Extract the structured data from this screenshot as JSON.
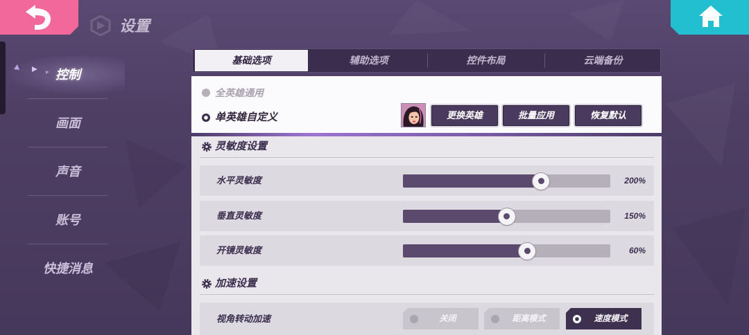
{
  "header": {
    "title": "设置",
    "back_icon": "back-arrow-icon",
    "home_icon": "home-icon",
    "logo_icon": "game-logo-icon"
  },
  "colors": {
    "back_button": "#f2689a",
    "home_button": "#22bfd0",
    "accent": "#3b2e4e",
    "slider_fill": "#5c4a6e",
    "slider_track": "#b4afb9"
  },
  "sidebar": {
    "items": [
      {
        "label": "控制",
        "active": true
      },
      {
        "label": "画面",
        "active": false
      },
      {
        "label": "声音",
        "active": false
      },
      {
        "label": "账号",
        "active": false
      },
      {
        "label": "快捷消息",
        "active": false
      }
    ]
  },
  "tabs": [
    {
      "label": "基础选项",
      "active": true
    },
    {
      "label": "辅助选项",
      "active": false
    },
    {
      "label": "控件布局",
      "active": false
    },
    {
      "label": "云端备份",
      "active": false
    }
  ],
  "hero_scope": {
    "options": [
      {
        "label": "全英雄通用",
        "selected": false
      },
      {
        "label": "单英雄自定义",
        "selected": true
      }
    ],
    "avatar_icon": "hero-portrait",
    "buttons": [
      {
        "label": "更换英雄"
      },
      {
        "label": "批量应用"
      },
      {
        "label": "恢复默认"
      }
    ]
  },
  "sensitivity": {
    "title": "灵敏度设置",
    "icon": "gear-icon",
    "rows": [
      {
        "label": "水平灵敏度",
        "value": "200%",
        "level": 0.667
      },
      {
        "label": "垂直灵敏度",
        "value": "150%",
        "level": 0.5
      },
      {
        "label": "开镜灵敏度",
        "value": "60%",
        "level": 0.6
      }
    ]
  },
  "acceleration": {
    "title": "加速设置",
    "icon": "gear-icon",
    "rows": [
      {
        "label": "视角转动加速",
        "options": [
          {
            "label": "关闭",
            "selected": false
          },
          {
            "label": "距离模式",
            "selected": false
          },
          {
            "label": "速度模式",
            "selected": true
          }
        ]
      }
    ]
  }
}
